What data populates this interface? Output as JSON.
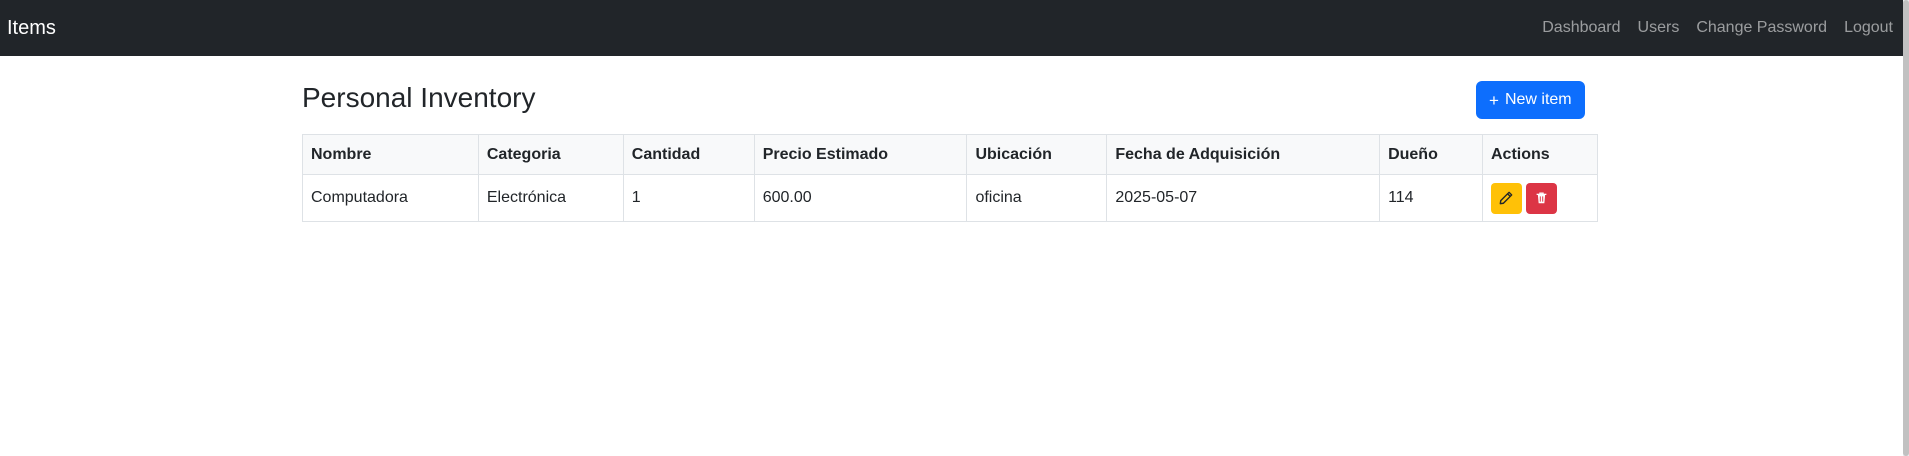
{
  "navbar": {
    "brand": "Items",
    "links": [
      "Dashboard",
      "Users",
      "Change Password",
      "Logout"
    ]
  },
  "page": {
    "title": "Personal Inventory",
    "new_button_label": "New item"
  },
  "table": {
    "headers": [
      "Nombre",
      "Categoria",
      "Cantidad",
      "Precio Estimado",
      "Ubicación",
      "Fecha de Adquisición",
      "Dueño",
      "Actions"
    ],
    "rows": [
      [
        "Computadora",
        "Electrónica",
        "1",
        "600.00",
        "oficina",
        "2025-05-07",
        "114"
      ]
    ]
  },
  "icons": {
    "new": "plus-icon",
    "edit": "pencil-icon",
    "delete": "trash-icon"
  },
  "colors": {
    "navbar_bg": "#212529",
    "primary": "#0d6efd",
    "warning": "#ffc107",
    "danger": "#dc3545"
  }
}
